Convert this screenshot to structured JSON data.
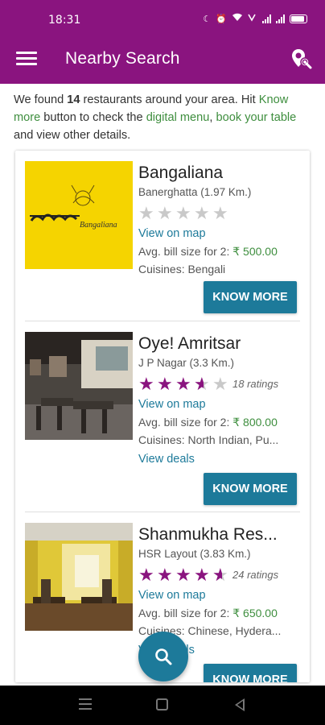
{
  "status_bar": {
    "time": "18:31"
  },
  "app_bar": {
    "title": "Nearby Search"
  },
  "intro": {
    "part1": "We found ",
    "count": "14",
    "part2": " restaurants around your area. Hit ",
    "know_more": "Know more",
    "part3": " button to check the ",
    "digital_menu": "digital menu",
    "comma": ", ",
    "book_table": "book your table",
    "part4": " and view other details."
  },
  "restaurants": [
    {
      "name": "Bangaliana",
      "location": "Banerghatta (1.97 Km.)",
      "rating": 0,
      "ratings_text": "",
      "view_on_map": "View on map",
      "bill_label": "Avg. bill size for 2: ",
      "bill_value": "₹ 500.00",
      "cuisines": "Cuisines: Bengali",
      "view_deals": "",
      "button": "KNOW MORE",
      "logo_text": "Bangaliana"
    },
    {
      "name": "Oye! Amritsar",
      "location": "J P Nagar (3.3 Km.)",
      "rating": 3.5,
      "ratings_text": "18 ratings",
      "view_on_map": "View on map",
      "bill_label": "Avg. bill size for 2: ",
      "bill_value": "₹ 800.00",
      "cuisines": "Cuisines: North Indian, Pu...",
      "view_deals": "View deals",
      "button": "KNOW MORE"
    },
    {
      "name": "Shanmukha Res...",
      "location": "HSR Layout (3.83 Km.)",
      "rating": 4.5,
      "ratings_text": "24 ratings",
      "view_on_map": "View on map",
      "bill_label": "Avg. bill size for 2: ",
      "bill_value": "₹ 650.00",
      "cuisines": "Cuisines: Chinese, Hydera...",
      "view_deals": "View deals",
      "button": "KNOW MORE"
    }
  ],
  "colors": {
    "primary": "#8a147f",
    "accent": "#1d7a9a",
    "price": "#3e8e3e"
  },
  "icons": [
    "menu-icon",
    "location-search-icon",
    "search-icon"
  ]
}
